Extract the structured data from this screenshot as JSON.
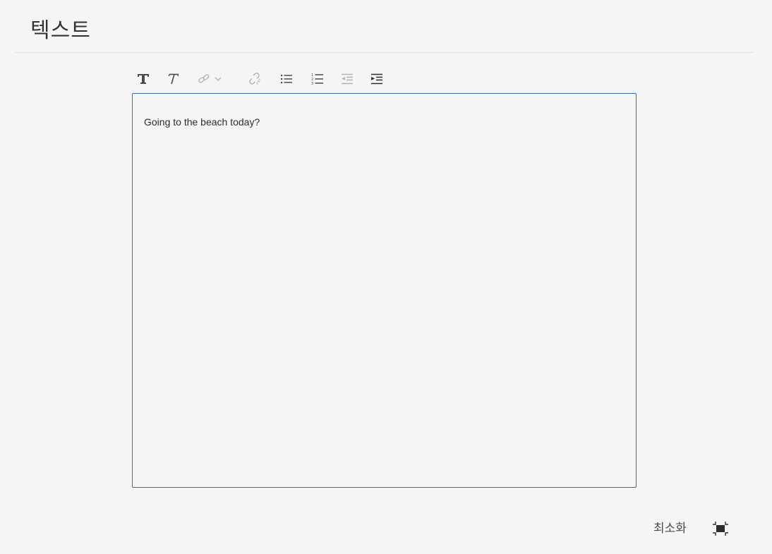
{
  "header": {
    "title": "텍스트"
  },
  "toolbar": {
    "buttons": [
      {
        "name": "format-bold-text",
        "icon": "text-format-icon"
      },
      {
        "name": "format-italic-text",
        "icon": "text-italic-icon"
      },
      {
        "name": "link",
        "icon": "link-icon"
      },
      {
        "name": "unlink",
        "icon": "unlink-icon"
      },
      {
        "name": "bulleted-list",
        "icon": "bulleted-list-icon"
      },
      {
        "name": "numbered-list",
        "icon": "numbered-list-icon"
      },
      {
        "name": "outdent",
        "icon": "outdent-icon"
      },
      {
        "name": "indent",
        "icon": "indent-icon"
      }
    ]
  },
  "editor": {
    "content": "Going to the beach today?"
  },
  "footer": {
    "minimize_label": "최소화"
  },
  "colors": {
    "accent": "#2d6bc4",
    "icon": "#4b4b4b",
    "icon_disabled": "#b3b3b3"
  }
}
